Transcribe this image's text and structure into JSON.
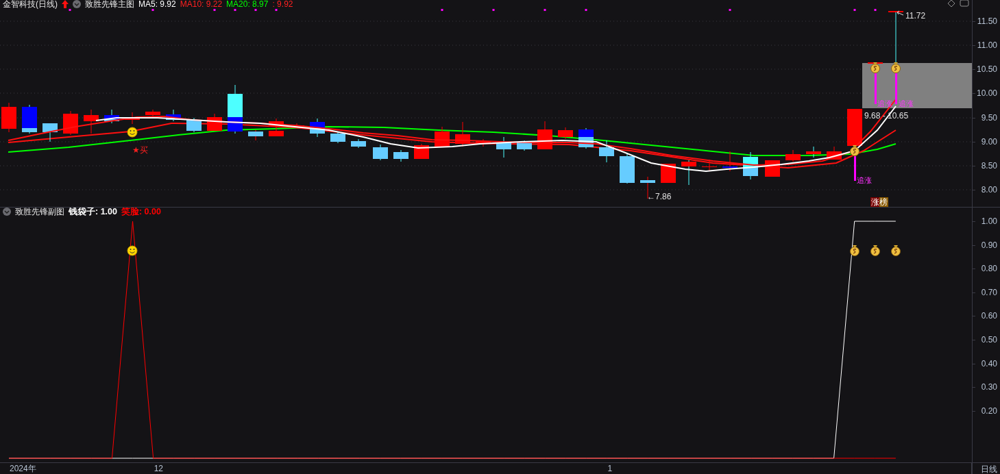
{
  "header": {
    "symbol": "金智科技(日线)",
    "indicator": "致胜先锋主图",
    "values": [
      {
        "label": "MA5: 9.92",
        "color": "#ffffff"
      },
      {
        "label": "MA10: 9.22",
        "color": "#ff2020"
      },
      {
        "label": "MA20: 8.97",
        "color": "#00ff00"
      },
      {
        "label": ": 9.92",
        "color": "#ff2020"
      }
    ]
  },
  "price_axis": [
    "11.50",
    "11.00",
    "10.50",
    "10.00",
    "9.50",
    "9.00",
    "8.50",
    "8.00"
  ],
  "annotations": {
    "buy": "★买",
    "chase": [
      "追涨",
      "追涨",
      "追涨"
    ],
    "range": "9.68 - 10.65",
    "high": "11.72",
    "low": "←7.86",
    "badge": "涨榜"
  },
  "sub_chart": {
    "header": {
      "indicator": "致胜先锋副图",
      "values": [
        {
          "label": "钱袋子: 1.00",
          "color": "#ffffff"
        },
        {
          "label": "笑脸: 0.00",
          "color": "#ff0000"
        }
      ]
    },
    "value_axis": [
      "1.00",
      "0.90",
      "0.80",
      "0.70",
      "0.60",
      "0.50",
      "0.40",
      "0.30",
      "0.20"
    ]
  },
  "time_axis": {
    "labels": [
      "2024年",
      "12",
      "1"
    ],
    "period": "日线"
  }
}
